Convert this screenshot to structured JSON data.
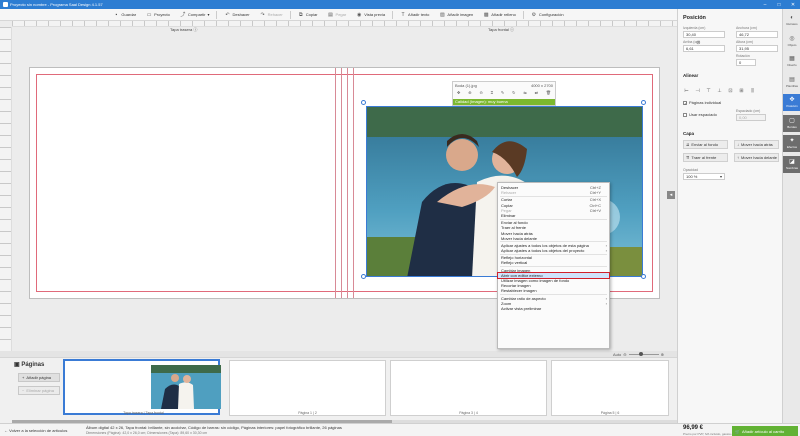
{
  "window": {
    "title": "Proyecto sin nombre - Programa Saal Design 4.1.57"
  },
  "toolbar": {
    "items": [
      {
        "label": "Guardar",
        "icon": "save-icon"
      },
      {
        "label": "Proyecto",
        "icon": "folder-icon"
      },
      {
        "label": "Compartir",
        "icon": "share-icon"
      },
      {
        "label": "Deshacer",
        "icon": "undo-icon"
      },
      {
        "label": "Rehacer",
        "icon": "redo-icon"
      },
      {
        "label": "Copiar",
        "icon": "copy-icon"
      },
      {
        "label": "Pegar",
        "icon": "paste-icon"
      },
      {
        "label": "Vista previa",
        "icon": "eye-icon"
      },
      {
        "label": "Añadir texto",
        "icon": "text-icon"
      },
      {
        "label": "Añadir imagen",
        "icon": "image-icon"
      },
      {
        "label": "Añadir relleno",
        "icon": "fill-icon"
      },
      {
        "label": "Configuración",
        "icon": "gear-icon"
      }
    ]
  },
  "canvas": {
    "left_cover_label": "Tapa trasera",
    "right_cover_label": "Tapa frontal",
    "info": "ⓘ"
  },
  "image_toolbar": {
    "filename": "Boda (1).jpg",
    "dimensions": "4000 x 2700",
    "quality": "Calidad (Imagen): muy buena"
  },
  "context_menu": {
    "items": [
      {
        "label": "Deshacer",
        "shortcut": "Ctrl+Z"
      },
      {
        "label": "Rehacer",
        "shortcut": "Ctrl+Y",
        "disabled": true
      },
      {
        "sep": true
      },
      {
        "label": "Cortar",
        "shortcut": "Ctrl+X"
      },
      {
        "label": "Copiar",
        "shortcut": "Ctrl+C"
      },
      {
        "label": "Pegar",
        "shortcut": "Ctrl+V",
        "disabled": true
      },
      {
        "label": "Eliminar"
      },
      {
        "sep": true
      },
      {
        "label": "Enviar al fondo"
      },
      {
        "label": "Traer al frente"
      },
      {
        "label": "Mover hacia atrás"
      },
      {
        "label": "Mover hacia delante"
      },
      {
        "sep": true
      },
      {
        "label": "Aplicar ajustes a todos los objetos de esta página",
        "submenu": true
      },
      {
        "label": "Aplicar ajustes a todos los objetos del proyecto",
        "submenu": true
      },
      {
        "sep": true
      },
      {
        "label": "Reflejo horizontal"
      },
      {
        "label": "Reflejo vertical"
      },
      {
        "sep": true
      },
      {
        "label": "Cambiar imagen"
      },
      {
        "label": "Abrir con editor externo",
        "highlight": true
      },
      {
        "label": "Utilizar imagen como imagen de fondo"
      },
      {
        "label": "Recortar imagen"
      },
      {
        "label": "Restablecer imagen"
      },
      {
        "sep": true
      },
      {
        "label": "Cambiar ratio de aspecto",
        "submenu": true
      },
      {
        "label": "Zoom",
        "submenu": true
      },
      {
        "label": "Activar vista preliminar"
      }
    ]
  },
  "zoom": {
    "label": "Auto"
  },
  "pages_panel": {
    "title": "Páginas",
    "add_page": "Añadir página",
    "delete_page": "Eliminar página",
    "thumbnails": [
      {
        "label": "Tapa trasera | Tapa frontal",
        "has_photo": true,
        "selected": true
      },
      {
        "label": "Página 1 | 2"
      },
      {
        "label": "Página 3 | 4"
      },
      {
        "label": "Página 5 | 6"
      }
    ]
  },
  "properties": {
    "title": "Posición",
    "fields": {
      "left_label": "Izquierda (cm)",
      "left": "30,40",
      "top_label": "Arriba (cm)",
      "top": "6,61",
      "width_label": "Anchura (cm)",
      "width": "46,72",
      "height_label": "Altura (cm)",
      "height": "31,95",
      "rotation_label": "Rotación",
      "rotation": "0"
    },
    "align_title": "Alinear",
    "individual_pages": "Páginas individual",
    "use_spacing": "Usar espaciado",
    "spacing_label": "Espaciado (cm)",
    "spacing": "0,00",
    "layers_title": "Capa",
    "layer_buttons": [
      "Enviar al fondo",
      "Mover hacia atrás",
      "Traer al frente",
      "Mover hacia delante"
    ],
    "opacity_label": "Opacidad",
    "opacity": "100 %"
  },
  "right_rail": [
    {
      "label": "Retratos",
      "icon": "portrait-icon"
    },
    {
      "label": "Objeto",
      "icon": "object-icon"
    },
    {
      "label": "Diseño",
      "icon": "layout-icon"
    },
    {
      "label": "Plantillas",
      "icon": "template-icon"
    },
    {
      "label": "Posición",
      "icon": "move-icon",
      "active": true
    },
    {
      "label": "Bordes",
      "icon": "border-icon",
      "dark": true
    },
    {
      "label": "Efectos",
      "icon": "effects-icon",
      "dark": true
    },
    {
      "label": "Sombras",
      "icon": "shadow-icon",
      "dark": true
    }
  ],
  "status": {
    "back": "Volver a la selección de artículos",
    "description": "Álbum digital 42 x 26, Tapa frontal: brillante, sin acolchar, Código de barras: sin código, Páginas interiores: papel fotográfico brillante, 26 páginas",
    "dimensions": "Dimensiones (Página): 42,0 x 26,0 cm; Dimensiones (Tapa): 89,60 x 30,30 cm",
    "price": "96,99 €",
    "price_note": "Precio por PVP, IVA incluido, gastos de envío",
    "cart_button": "Añadir artículo al carrito"
  }
}
